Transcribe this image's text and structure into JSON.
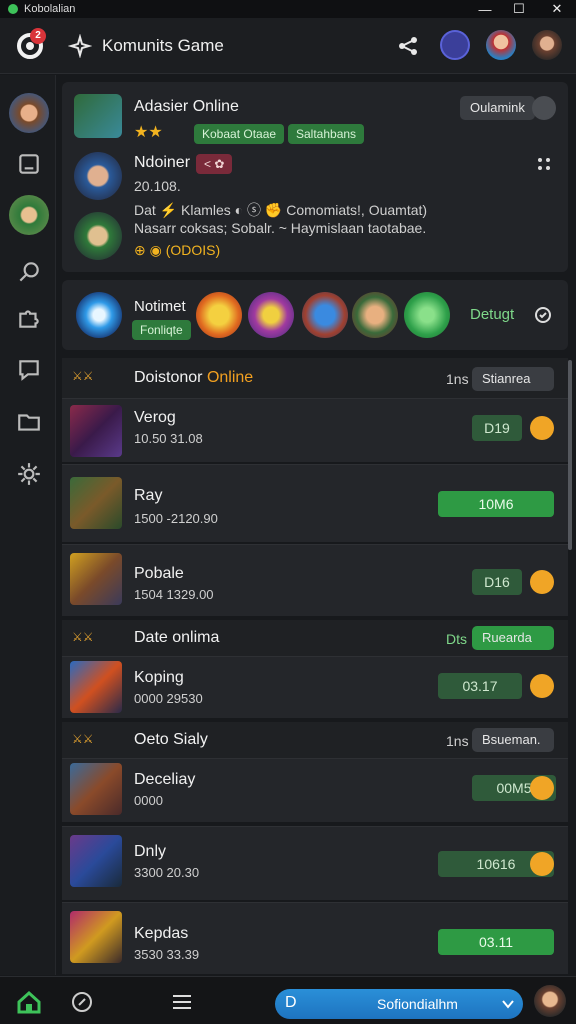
{
  "window": {
    "title": "Kobolalian",
    "controls": {
      "minimize": "—",
      "maximize": "☐",
      "close": "✕"
    }
  },
  "header": {
    "notification_count": "2",
    "app_title": "Komunits Game"
  },
  "profile_card": {
    "name": "Adasier Online",
    "stars": "★★",
    "tags": [
      "Kobaat Otaae",
      "Saltahbans"
    ],
    "entries": [
      {
        "name": "Ndoiner",
        "code": "< ✿",
        "lines": [
          "20.108.",
          "Dat ⚡ Klamles ◐ ⓢ ✊ Comomiats!, Ouamtat)"
        ]
      },
      {
        "lines": [
          "Nasarr coksas; Sobalr. ~ Haymislaan taotabae.",
          "⊕ ◉ (ODOIS)"
        ]
      }
    ]
  },
  "friends_strip": {
    "name": "Notimet",
    "tag": "Fonliqte",
    "action": "Detugt"
  },
  "section1": {
    "name_white": "Doistonor",
    "name_orange": "Online",
    "count": "1ns",
    "dropdown": "Stianrea"
  },
  "rows": [
    {
      "name": "Verog",
      "meta": "10.50   31.08",
      "score": "D19",
      "style": "dark"
    },
    {
      "name": "Ray",
      "meta": "1500 -2120.90",
      "score": "10M6",
      "style": "bright"
    },
    {
      "name": "Pobale",
      "meta": "1504 1329.00",
      "score": "D16",
      "style": "dark"
    }
  ],
  "section2": {
    "name": "Date onlima",
    "count": "Dts",
    "dropdown": "Ruearda"
  },
  "rows2": [
    {
      "name": "Koping",
      "meta": "0000   29530",
      "score": "03.17",
      "style": "dark"
    }
  ],
  "section3": {
    "name": "Oeto Sialy",
    "count": "1ns",
    "dropdown": "Bsueman."
  },
  "rows3": [
    {
      "name": "Deceliay",
      "meta": "0000",
      "score": "00M5",
      "style": "dark"
    },
    {
      "name": "Dnly",
      "meta": "3300   20.30",
      "score": "10616",
      "style": "dark"
    },
    {
      "name": "Kepdas",
      "meta": "3530   33.39",
      "score": "03.11",
      "style": "bright"
    }
  ],
  "bottom": {
    "pill_left": "D",
    "pill_label": "Sofiondialhm"
  },
  "colors": {
    "accent_green": "#2e9a44",
    "accent_orange": "#f0a526",
    "accent_blue": "#2a8fd8",
    "danger": "#d9343a"
  }
}
